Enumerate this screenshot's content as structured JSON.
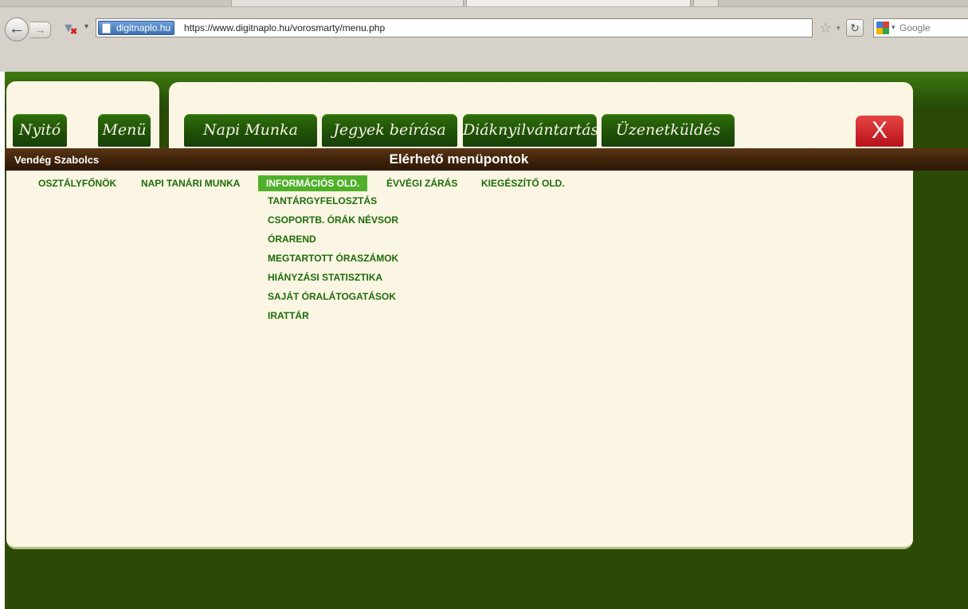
{
  "browser": {
    "site_identity": "digitnaplo.hu",
    "url": "https://www.digitnaplo.hu/vorosmarty/menu.php",
    "search_placeholder": "Google"
  },
  "nav_tabs": {
    "left": [
      "Nyitó",
      "Menü"
    ],
    "main": [
      "Napi Munka",
      "Jegyek beírása",
      "Diáknyilvántartás",
      "Üzenetküldés"
    ],
    "close": "X"
  },
  "titlebar": {
    "user": "Vendég Szabolcs",
    "title": "Elérhető menüpontok"
  },
  "menu": {
    "top": [
      "OSZTÁLYFŐNÖK",
      "NAPI TANÁRI MUNKA",
      "INFORMÁCIÓS OLD.",
      "ÉVVÉGI ZÁRÁS",
      "KIEGÉSZÍTŐ OLD."
    ],
    "active_index": 2,
    "submenu": [
      "TANTÁRGYFELOSZTÁS",
      "CSOPORTB. ÓRÁK NÉVSOR",
      "ÓRAREND",
      "MEGTARTOTT ÓRASZÁMOK",
      "HIÁNYZÁSI STATISZTIKA",
      "SAJÁT ÓRALÁTOGATÁSOK",
      "IRATTÁR"
    ]
  },
  "colors": {
    "page_bg": "#2b4a06",
    "panel_bg": "#fbf6e4",
    "menu_text": "#1e6b0a",
    "active_menu_bg": "#4fb02a",
    "titlebar_bg": "#3b2008",
    "close_button": "#d42020"
  }
}
